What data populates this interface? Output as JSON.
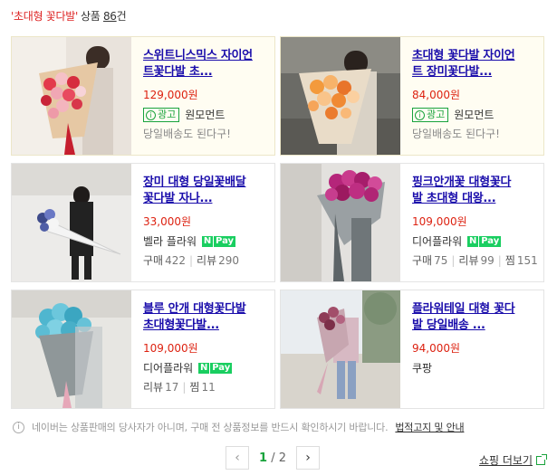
{
  "header": {
    "query": "'초대형 꽃다발'",
    "label": "상품",
    "count": "86",
    "unit": "건"
  },
  "products": [
    {
      "title_line1": "스위트니스믹스 자이언",
      "title_line2": "트꽃다발 초...",
      "price": "129,000원",
      "ad_label": "광고",
      "seller": "원모먼트",
      "subtext": "당일배송도 된다구!"
    },
    {
      "title_line1": "초대형 꽃다발 자이언",
      "title_line2": "트 장미꽃다발...",
      "price": "84,000원",
      "ad_label": "광고",
      "seller": "원모먼트",
      "subtext": "당일배송도 된다구!"
    },
    {
      "title_line1": "장미 대형 당일꽃배달",
      "title_line2": "꽃다발 자나...",
      "price": "33,000원",
      "seller": "벨라 플라워",
      "pay": "Pay",
      "stats": [
        {
          "k": "구매",
          "v": "422"
        },
        {
          "k": "리뷰",
          "v": "290"
        }
      ]
    },
    {
      "title_line1": "핑크안개꽃 대형꽃다",
      "title_line2": "발 초대형 대왕...",
      "price": "109,000원",
      "seller": "디어플라워",
      "pay": "Pay",
      "stats": [
        {
          "k": "구매",
          "v": "75"
        },
        {
          "k": "리뷰",
          "v": "99"
        },
        {
          "k": "찜",
          "v": "151"
        }
      ]
    },
    {
      "title_line1": "블루 안개 대형꽃다발",
      "title_line2": "초대형꽃다발...",
      "price": "109,000원",
      "seller": "디어플라워",
      "pay": "Pay",
      "stats": [
        {
          "k": "리뷰",
          "v": "17"
        },
        {
          "k": "찜",
          "v": "11"
        }
      ]
    },
    {
      "title_line1": "플라워테일 대형 꽃다",
      "title_line2": "발 당일배송 ...",
      "price": "94,000원",
      "seller": "쿠팡"
    }
  ],
  "notice": {
    "text": "네이버는 상품판매의 당사자가 아니며, 구매 전 상품정보를 반드시 확인하시기 바랍니다.",
    "link": "법적고지 및 안내"
  },
  "pagination": {
    "current": "1",
    "total": "2",
    "sep": "/"
  },
  "more_label": "쇼핑 더보기",
  "colors": {
    "price": "#dd2211",
    "link": "#1a0dab",
    "naver_green": "#19ce60",
    "ad_bg": "#fffdf2"
  }
}
